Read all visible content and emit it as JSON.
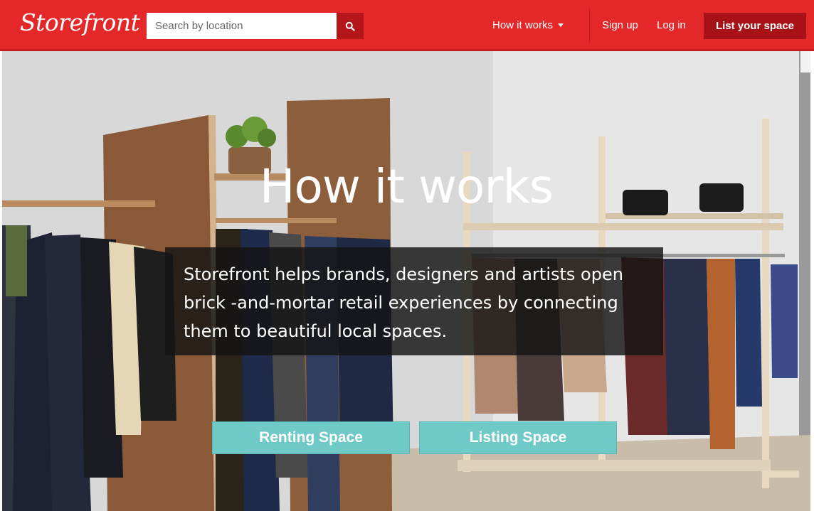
{
  "header": {
    "logo": "Storefront",
    "search": {
      "placeholder": "Search by location",
      "value": "",
      "icon": "search-icon"
    },
    "nav": {
      "how_it_works": "How it works",
      "sign_up": "Sign up",
      "log_in": "Log in",
      "list_your_space": "List your space"
    }
  },
  "hero": {
    "title": "How it works",
    "tagline": "Storefront helps brands, designers and artists open brick -and-mortar retail experiences by connecting them to beautiful local spaces.",
    "buttons": {
      "renting": "Renting Space",
      "listing": "Listing Space"
    }
  },
  "colors": {
    "brand_red": "#e42728",
    "dark_red": "#a81216",
    "teal": "#6fc9c7"
  }
}
